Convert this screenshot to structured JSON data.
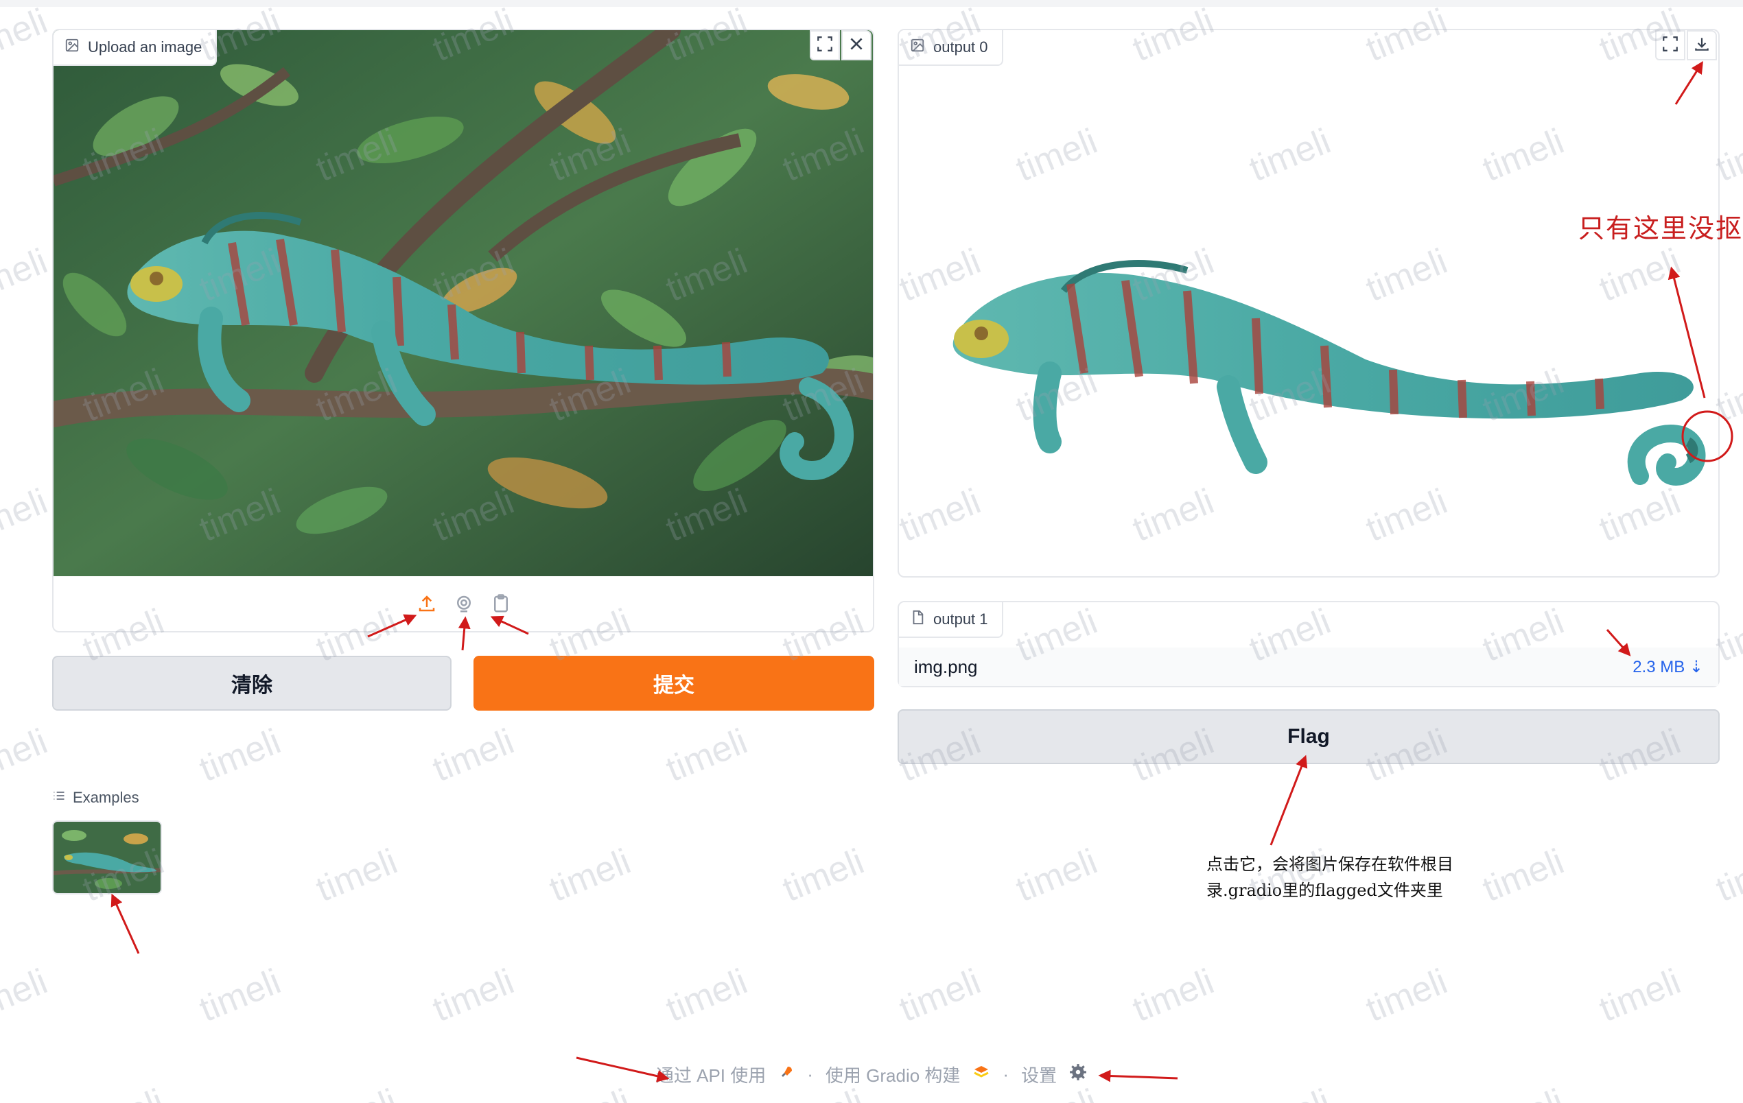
{
  "input_panel": {
    "label": "Upload an image",
    "label_icon": "image-icon",
    "fullscreen_icon": "fullscreen-icon",
    "close_icon": "close-icon",
    "source_icons": [
      "upload-icon",
      "webcam-icon",
      "clipboard-icon"
    ]
  },
  "buttons": {
    "clear": "清除",
    "submit": "提交",
    "flag": "Flag"
  },
  "examples": {
    "label": "Examples",
    "icon": "list-icon"
  },
  "output0": {
    "label": "output 0",
    "fullscreen_icon": "fullscreen-icon",
    "download_icon": "download-icon"
  },
  "output1": {
    "label": "output 1",
    "file_name": "img.png",
    "file_size": "2.3 MB ⇣"
  },
  "annotations": {
    "not_removed": "只有这里没抠",
    "flag_note_line1": "点击它，会将图片保存在软件根目",
    "flag_note_line2": "录.gradio里的flagged文件夹里"
  },
  "footer": {
    "api": "通过 API 使用",
    "sep": "·",
    "built_with": "使用 Gradio 构建",
    "settings": "设置"
  },
  "watermark": "timeli",
  "colors": {
    "accent": "#f97316",
    "annotation_red": "#c81e1e",
    "link_blue": "#2563eb"
  }
}
